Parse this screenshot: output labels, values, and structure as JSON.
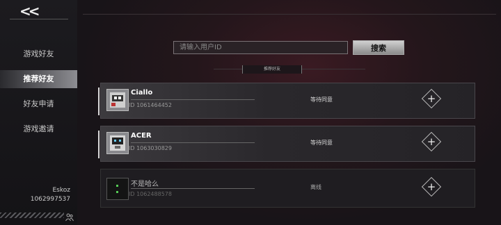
{
  "nav": {
    "back_glyph": "<<",
    "items": [
      {
        "label": "游戏好友"
      },
      {
        "label": "推荐好友"
      },
      {
        "label": "好友申请"
      },
      {
        "label": "游戏邀请"
      }
    ]
  },
  "user": {
    "name": "Eskoz",
    "id": "1062997537"
  },
  "search": {
    "placeholder": "请输入用户ID",
    "button": "搜索"
  },
  "section": {
    "title": "推荐好友"
  },
  "friends": [
    {
      "name": "Ciallo",
      "id": "ID 1061464452",
      "status": "等待同意",
      "add": "+"
    },
    {
      "name": "ACER",
      "id": "ID 1063030829",
      "status": "等待同意",
      "add": "+"
    },
    {
      "name": "不是哈么",
      "id": "ID 1062488578",
      "status": "离线",
      "add": "+"
    }
  ],
  "colors": {
    "accent": "#d8d8d8",
    "background": "#181418",
    "highlight": "#3a1a22"
  }
}
